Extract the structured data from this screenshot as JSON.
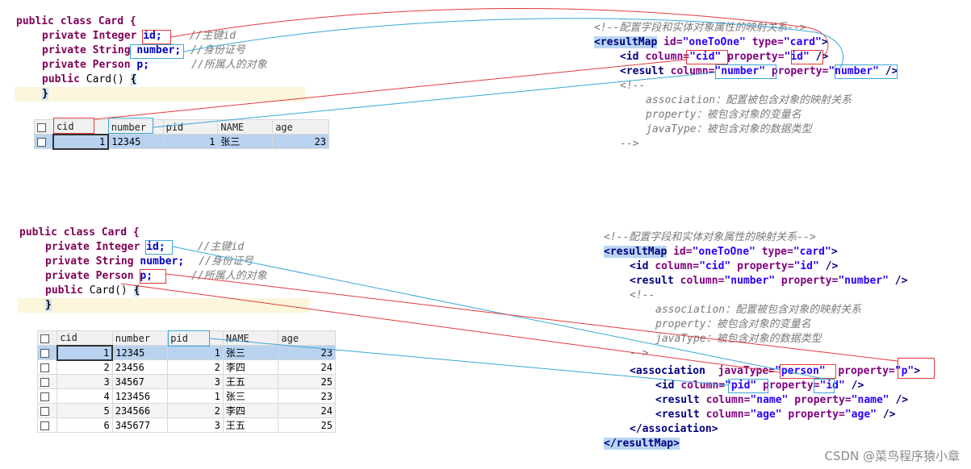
{
  "top": {
    "java": {
      "l1": "public class Card {",
      "l2a": "private Integer ",
      "l2b": "id;",
      "l2c": "//主键id",
      "l3a": "private String ",
      "l3b": "number;",
      "l3c": "//身份证号",
      "l4a": "private Person ",
      "l4b": "p;",
      "l4c": "//所属人的对象",
      "l5a": "public ",
      "l5b": "Card() ",
      "l5c": "{",
      "l6": "}"
    },
    "table": {
      "columns": [
        "cid",
        "number",
        "pid",
        "NAME",
        "age"
      ],
      "rows": [
        [
          "1",
          "12345",
          "1",
          "张三",
          "23"
        ]
      ]
    },
    "xml": {
      "c1": "<!--配置字段和实体对象属性的映射关系-->",
      "rm_open": "<resultMap",
      "rm_attr1": "id=",
      "rm_val1": "\"oneToOne\"",
      "rm_attr2": "type=",
      "rm_val2": "\"card\"",
      "rm_close": ">",
      "id_tag": "<id",
      "id_col_attr": "column=",
      "id_col_val": "\"cid\"",
      "id_prop_attr": "property=",
      "id_prop_val": "\"id\"",
      "id_end": "/>",
      "res_tag": "<result",
      "res_col_attr": "column=",
      "res_col_val": "\"number\"",
      "res_prop_attr": "property=",
      "res_prop_val": "\"number\"",
      "res_end": "/>",
      "c2": "<!--",
      "c3": "association：配置被包含对象的映射关系",
      "c4": "property：被包含对象的变量名",
      "c5": "javaType：被包含对象的数据类型",
      "c6": "-->"
    }
  },
  "bottom": {
    "java": {
      "l1": "public class Card {",
      "l2a": "private Integer ",
      "l2b": "id;",
      "l2c": "//主键id",
      "l3a": "private String ",
      "l3b": "number;",
      "l3c": "//身份证号",
      "l4a": "private Person ",
      "l4b": "p;",
      "l4c": "//所属人的对象",
      "l5a": "public ",
      "l5b": "Card() ",
      "l5c": "{",
      "l6": "}"
    },
    "table": {
      "columns": [
        "cid",
        "number",
        "pid",
        "NAME",
        "age"
      ],
      "rows": [
        [
          "1",
          "12345",
          "1",
          "张三",
          "23"
        ],
        [
          "2",
          "23456",
          "2",
          "李四",
          "24"
        ],
        [
          "3",
          "34567",
          "3",
          "王五",
          "25"
        ],
        [
          "4",
          "123456",
          "1",
          "张三",
          "23"
        ],
        [
          "5",
          "234566",
          "2",
          "李四",
          "24"
        ],
        [
          "6",
          "345677",
          "3",
          "王五",
          "25"
        ]
      ]
    },
    "xml": {
      "c1": "<!--配置字段和实体对象属性的映射关系-->",
      "rm_open": "<resultMap",
      "rm_attr1": "id=",
      "rm_val1": "\"oneToOne\"",
      "rm_attr2": "type=",
      "rm_val2": "\"card\"",
      "rm_close": ">",
      "id_tag": "<id",
      "id_col_attr": "column=",
      "id_col_val": "\"cid\"",
      "id_prop_attr": "property=",
      "id_prop_val": "\"id\"",
      "id_end": "/>",
      "res_tag": "<result",
      "res_col_attr": "column=",
      "res_col_val": "\"number\"",
      "res_prop_attr": "property=",
      "res_prop_val": "\"number\"",
      "res_end": "/>",
      "c2": "<!--",
      "c3": "association：配置被包含对象的映射关系",
      "c4": "property：被包含对象的变量名",
      "c5": "javaType：被包含对象的数据类型",
      "c6": "-->",
      "as_tag": "<association",
      "as_jt_attr": "javaType=",
      "as_jt_val": "\"person\"",
      "as_prop_attr": "property=",
      "as_prop_val": "\"p\"",
      "as_close": ">",
      "aid_tag": "<id",
      "aid_col_attr": "column=",
      "aid_col_val": "\"pid\"",
      "aid_prop_attr": "property=",
      "aid_prop_val": "\"id\"",
      "aid_end": "/>",
      "r1_tag": "<result",
      "r1_col_attr": "column=",
      "r1_col_val": "\"name\"",
      "r1_prop_attr": "property=",
      "r1_prop_val": "\"name\"",
      "r1_end": "/>",
      "r2_tag": "<result",
      "r2_col_attr": "column=",
      "r2_col_val": "\"age\"",
      "r2_prop_attr": "property=",
      "r2_prop_val": "\"age\"",
      "r2_end": "/>",
      "as_end": "</association>",
      "rm_end": "</resultMap>"
    }
  },
  "watermark": "CSDN @菜鸟程序猿小章",
  "colors": {
    "red_link": "#e23a3a",
    "blue_link": "#3aa7d6"
  }
}
